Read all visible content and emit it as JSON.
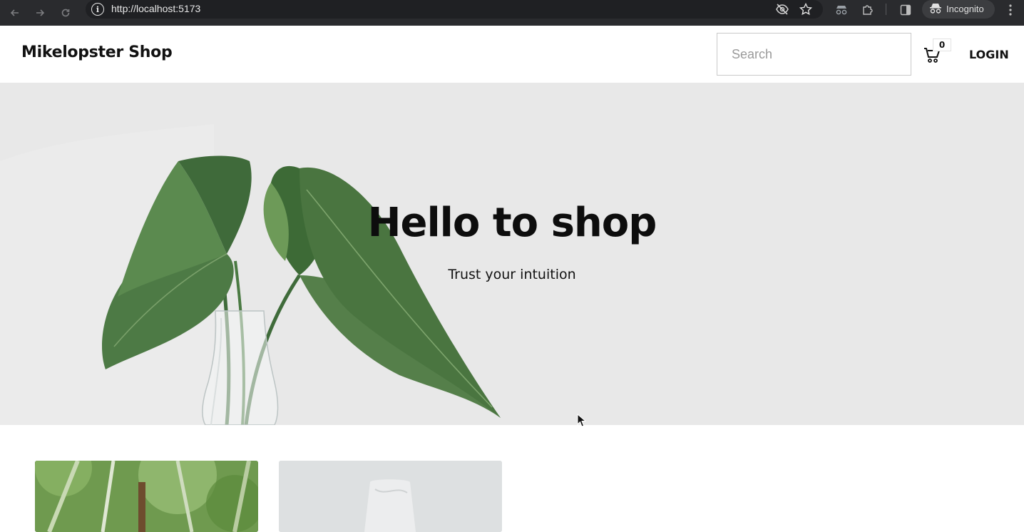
{
  "browser": {
    "url": "http://localhost:5173",
    "incognito_label": "Incognito",
    "icons": [
      "back-arrow-icon",
      "forward-arrow-icon",
      "reload-icon",
      "site-info-icon",
      "eye-off-icon",
      "bookmark-star-icon",
      "incognito-extension-icon",
      "extensions-puzzle-icon",
      "side-panel-icon",
      "incognito-icon",
      "kebab-menu-icon"
    ]
  },
  "header": {
    "brand": "Mikelopster Shop",
    "search_placeholder": "Search",
    "cart_count": "0",
    "login_label": "LOGIN"
  },
  "hero": {
    "title": "Hello to shop",
    "subtitle": "Trust your intuition"
  },
  "products": [
    {
      "image": "bamboo-forest"
    },
    {
      "image": "white-cosmetic-tube"
    }
  ],
  "colors": {
    "hero_bg": "#e8e8e8",
    "chrome_bg": "#2a2b2e"
  }
}
